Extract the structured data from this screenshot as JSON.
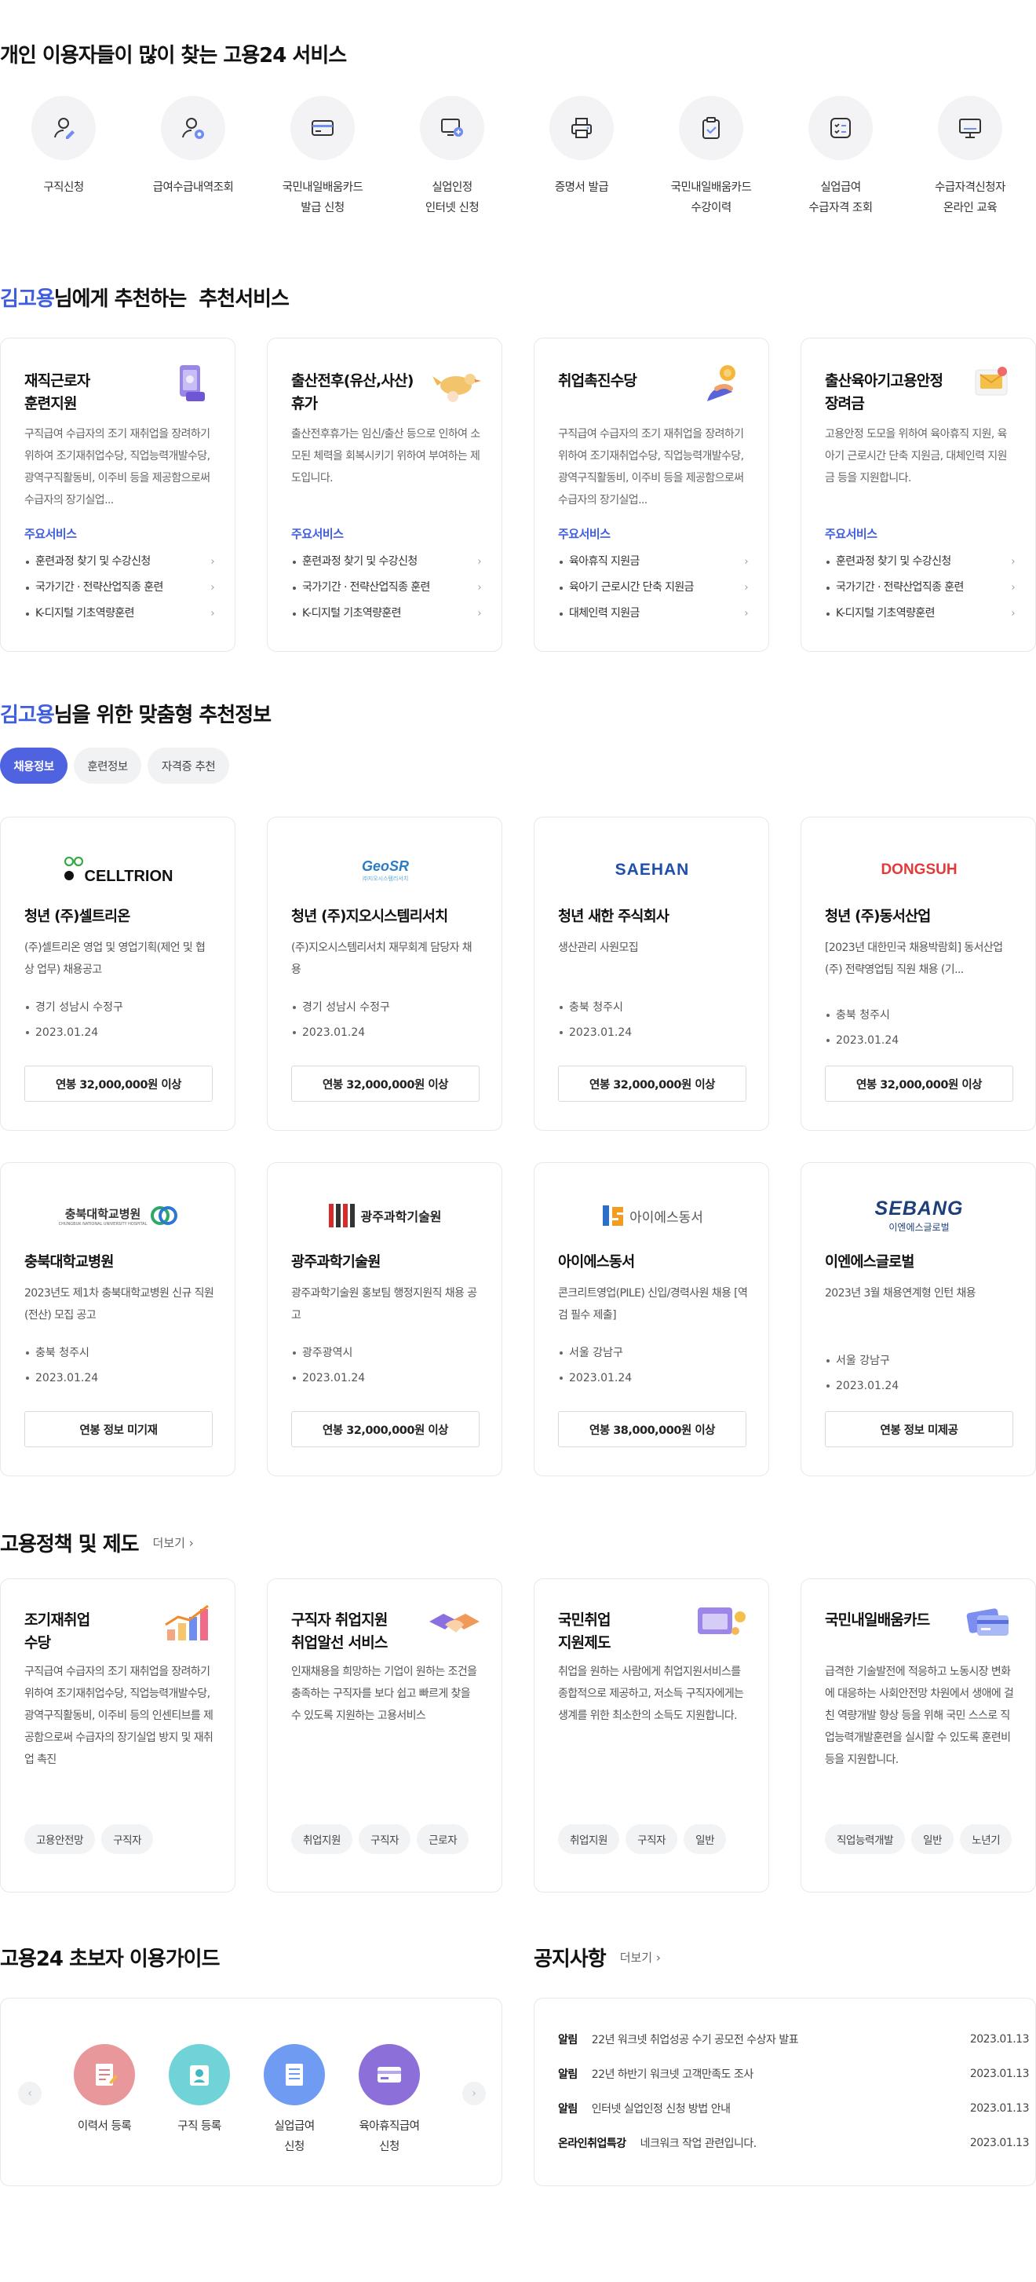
{
  "services": {
    "title": "개인 이용자들이 많이 찾는 고용24 서비스",
    "items": [
      {
        "icon": "job-seeker-icon",
        "label1": "구직신청",
        "label2": ""
      },
      {
        "icon": "benefit-lookup-icon",
        "label1": "급여수급내역조회",
        "label2": ""
      },
      {
        "icon": "card-icon",
        "label1": "국민내일배움카드",
        "label2": "발급 신청"
      },
      {
        "icon": "unemployment-online-icon",
        "label1": "실업인정",
        "label2": "인터넷 신청"
      },
      {
        "icon": "printer-icon",
        "label1": "증명서 발급",
        "label2": ""
      },
      {
        "icon": "clipboard-icon",
        "label1": "국민내일배움카드",
        "label2": "수강이력"
      },
      {
        "icon": "checklist-icon",
        "label1": "실업급여",
        "label2": "수급자격 조회"
      },
      {
        "icon": "monitor-icon",
        "label1": "수급자격신청자",
        "label2": "온라인 교육"
      }
    ]
  },
  "recommend": {
    "user": "김고용",
    "title_rest": "님에게 추천하는  추천서비스",
    "main_label": "주요서비스",
    "cards": [
      {
        "title": "재직근로자\n훈련지원",
        "desc": "구직급여 수급자의 조기 재취업을 장려하기 위하여 조기재취업수당, 직업능력개발수당, 광역구직활동비, 이주비 등을 제공함으로써 수급자의 장기실업...",
        "items": [
          "훈련과정 찾기 및 수강신청",
          "국가기간 · 전략산업직종 훈련",
          "K-디지털 기초역량훈련"
        ]
      },
      {
        "title": "출산전후(유산,사산)\n휴가",
        "desc": "출산전후휴가는 임신/출산 등으로 인하여 소모된 체력을 회복시키기 위하여 부여하는 제도입니다.",
        "items": [
          "훈련과정 찾기 및 수강신청",
          "국가기간 · 전략산업직종 훈련",
          "K-디지털 기초역량훈련"
        ]
      },
      {
        "title": "취업촉진수당",
        "desc": "구직급여 수급자의 조기 재취업을 장려하기 위하여 조기재취업수당, 직업능력개발수당, 광역구직활동비, 이주비 등을 제공함으로써 수급자의 장기실업...",
        "items": [
          "육아휴직 지원금",
          "육아기 근로시간 단축 지원금",
          "대체인력 지원금"
        ]
      },
      {
        "title": "출산육아기고용안정\n장려금",
        "desc": "고용안정 도모을 위하여 육아휴직 지원, 육아기 근로시간 단축 지원금, 대체인력 지원금 등을 지원합니다.",
        "items": [
          "훈련과정 찾기 및 수강신청",
          "국가기간 · 전략산업직종 훈련",
          "K-디지털 기초역량훈련"
        ]
      }
    ]
  },
  "custom": {
    "user": "김고용",
    "title_rest": "님을 위한 맞춤형 추천정보",
    "tabs": [
      "채용정보",
      "훈련정보",
      "자격증 추천"
    ],
    "jobs": [
      {
        "logo": "CELLTRION",
        "name": "청년 (주)셀트리온",
        "desc": "(주)셀트리온 영업 및 영업기획(제언 및 협상 업무) 채용공고",
        "loc": "경기 성남시 수정구",
        "date": "2023.01.24",
        "salary": "연봉 32,000,000원 이상"
      },
      {
        "logo": "GeoSR",
        "logo_sub": "㈜지오시스템리서치",
        "name": "청년 (주)지오시스템리서치",
        "desc": "(주)지오시스템리서치 재무회계 담당자 채용",
        "loc": "경기 성남시 수정구",
        "date": "2023.01.24",
        "salary": "연봉 32,000,000원 이상"
      },
      {
        "logo": "SAEHAN",
        "name": "청년 새한 주식회사",
        "desc": "생산관리 사원모집",
        "loc": "충북 청주시",
        "date": "2023.01.24",
        "salary": "연봉 32,000,000원 이상"
      },
      {
        "logo": "DONGSUH",
        "name": "청년 (주)동서산업",
        "desc": "[2023년 대한민국 채용박람회] 동서산업(주) 전략영업팀 직원 채용 (기...",
        "loc": "충북 청주시",
        "date": "2023.01.24",
        "salary": "연봉 32,000,000원 이상"
      },
      {
        "logo": "충북대학교병원",
        "logo_sub": "CHUNGBUK NATIONAL UNIVERSITY HOSPITAL",
        "name": "충북대학교병원",
        "desc": "2023년도 제1차 충북대학교병원 신규 직원(전산) 모집 공고",
        "loc": "충북 청주시",
        "date": "2023.01.24",
        "salary": "연봉 정보 미기재"
      },
      {
        "logo": "광주과학기술원",
        "name": "광주과학기술원",
        "desc": "광주과학기술원 홍보팀 행정지원직 채용 공고",
        "loc": "광주광역시",
        "date": "2023.01.24",
        "salary": "연봉 32,000,000원 이상"
      },
      {
        "logo": "아이에스동서",
        "name": "아이에스동서",
        "desc": "콘크리트영업(PILE) 신입/경력사원 채용 [역검 필수 제출]",
        "loc": "서울 강남구",
        "date": "2023.01.24",
        "salary": "연봉 38,000,000원 이상"
      },
      {
        "logo": "SEBANG",
        "logo_sub": "이엔에스글로벌",
        "name": "이엔에스글로벌",
        "desc": "2023년 3월 채용연계형 인턴 채용",
        "loc": "서울 강남구",
        "date": "2023.01.24",
        "salary": "연봉 정보 미제공"
      }
    ]
  },
  "policy": {
    "title": "고용정책 및 제도",
    "more": "더보기",
    "cards": [
      {
        "title": "조기재취업\n수당",
        "desc": "구직급여 수급자의 조기 재취업을 장려하기 위하여 조기재취업수당, 직업능력개발수당, 광역구직활동비, 이주비 등의 인센티브를 제공함으로써 수급자의 장기실업 방지 및 재취업 촉진",
        "tags": [
          "고용안전망",
          "구직자"
        ]
      },
      {
        "title": "구직자 취업지원\n취업알선 서비스",
        "desc": "인재채용을 희망하는 기업이 원하는 조건을 충족하는 구직자를 보다 쉽고 빠르게 찾을 수 있도록 지원하는 고용서비스",
        "tags": [
          "취업지원",
          "구직자",
          "근로자"
        ]
      },
      {
        "title": "국민취업\n지원제도",
        "desc": "취업을 원하는 사람에게 취업지원서비스를 종합적으로 제공하고, 저소득 구직자에게는 생계를 위한 최소한의 소득도 지원합니다.",
        "tags": [
          "취업지원",
          "구직자",
          "일반"
        ]
      },
      {
        "title": "국민내일배움카드",
        "desc": "급격한 기술발전에 적응하고 노동시장 변화에 대응하는 사회안전망 차원에서 생애에 걸친 역량개발 향상 등을 위해 국민 스스로 직업능력개발훈련을 실시할 수 있도록 훈련비 등을 지원합니다.",
        "tags": [
          "직업능력개발",
          "일반",
          "노년기"
        ]
      }
    ]
  },
  "guide": {
    "title": "고용24 초보자 이용가이드",
    "items": [
      {
        "label1": "이력서 등록",
        "label2": "",
        "color": "#e8979b"
      },
      {
        "label1": "구직 등록",
        "label2": "",
        "color": "#6fd3d8"
      },
      {
        "label1": "실업급여",
        "label2": "신청",
        "color": "#6f9cf2"
      },
      {
        "label1": "육아휴직급여",
        "label2": "신청",
        "color": "#8c6fd8"
      }
    ]
  },
  "notice": {
    "title": "공지사항",
    "more": "더보기",
    "rows": [
      {
        "cat": "알림",
        "text": "22년 워크넷 취업성공 수기 공모전 수상자 발표",
        "date": "2023.01.13"
      },
      {
        "cat": "알림",
        "text": "22년 하반기 워크넷 고객만족도 조사",
        "date": "2023.01.13"
      },
      {
        "cat": "알림",
        "text": "인터넷 실업인정 신청 방법 안내",
        "date": "2023.01.13"
      },
      {
        "cat": "온라인취업특강",
        "text": "네크워크 작업 관련입니다.",
        "date": "2023.01.13"
      }
    ]
  },
  "colors": {
    "accent": "#3f5de0",
    "tab_active": "#4f63e0"
  }
}
